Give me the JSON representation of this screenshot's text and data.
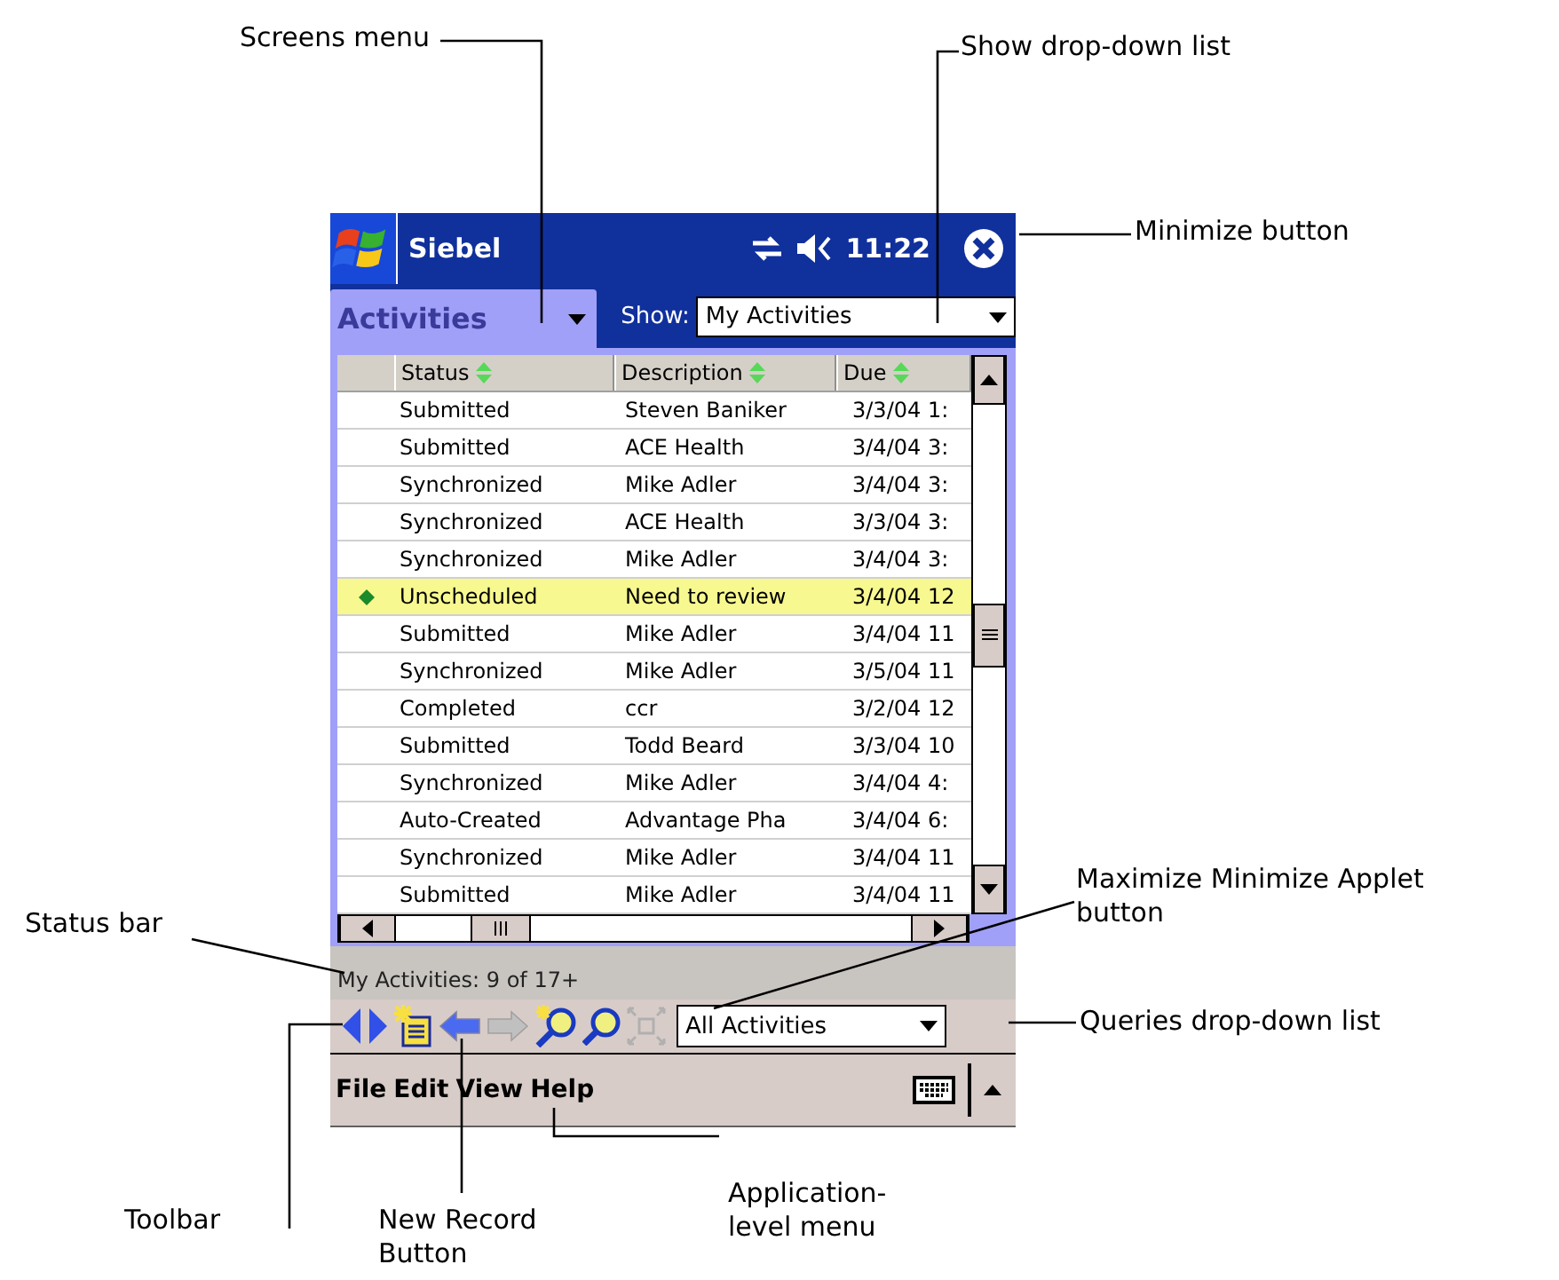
{
  "title_bar": {
    "title": "Siebel",
    "time": "11:22"
  },
  "screens_menu": {
    "label": "Activities"
  },
  "show": {
    "label": "Show:",
    "value": "My Activities"
  },
  "table": {
    "columns": [
      "Status",
      "Description",
      "Due"
    ],
    "rows": [
      {
        "status": "Submitted",
        "description": "Steven Baniker",
        "due": "3/3/04 1:",
        "selected": false
      },
      {
        "status": "Submitted",
        "description": "ACE Health",
        "due": "3/4/04 3:",
        "selected": false
      },
      {
        "status": "Synchronized",
        "description": "Mike Adler",
        "due": "3/4/04 3:",
        "selected": false
      },
      {
        "status": "Synchronized",
        "description": "ACE Health",
        "due": "3/3/04 3:",
        "selected": false
      },
      {
        "status": "Synchronized",
        "description": "Mike Adler",
        "due": "3/4/04 3:",
        "selected": false
      },
      {
        "status": "Unscheduled",
        "description": "Need to review",
        "due": "3/4/04 12",
        "selected": true
      },
      {
        "status": "Submitted",
        "description": "Mike Adler",
        "due": "3/4/04 11",
        "selected": false
      },
      {
        "status": "Synchronized",
        "description": "Mike Adler",
        "due": "3/5/04 11",
        "selected": false
      },
      {
        "status": "Completed",
        "description": "ccr",
        "due": "3/2/04 12",
        "selected": false
      },
      {
        "status": "Submitted",
        "description": "Todd Beard",
        "due": "3/3/04 10",
        "selected": false
      },
      {
        "status": "Synchronized",
        "description": "Mike Adler",
        "due": "3/4/04 4:",
        "selected": false
      },
      {
        "status": "Auto-Created",
        "description": "Advantage Pha",
        "due": "3/4/04 6:",
        "selected": false
      },
      {
        "status": "Synchronized",
        "description": "Mike Adler",
        "due": "3/4/04 11",
        "selected": false
      },
      {
        "status": "Submitted",
        "description": "Mike Adler",
        "due": "3/4/04 11",
        "selected": false
      }
    ]
  },
  "status_bar": "My Activities:  9 of 17+",
  "toolbar": [
    {
      "kind": "previous",
      "disabled": false
    },
    {
      "kind": "next",
      "disabled": false
    },
    {
      "kind": "new-record",
      "disabled": false
    },
    {
      "kind": "back",
      "disabled": false
    },
    {
      "kind": "forward",
      "disabled": true
    },
    {
      "kind": "new-query",
      "disabled": false
    },
    {
      "kind": "query",
      "disabled": false
    },
    {
      "kind": "maximize",
      "disabled": true
    }
  ],
  "queries": {
    "value": "All Activities"
  },
  "menu": [
    "File",
    "Edit",
    "View",
    "Help"
  ],
  "callouts": [
    "Screens menu",
    "Show drop-down list",
    "Minimize button",
    "Maximize Minimize Applet button",
    "Queries drop-down list",
    "Status bar",
    "Toolbar",
    "New Record Button",
    "Application-level menu"
  ]
}
